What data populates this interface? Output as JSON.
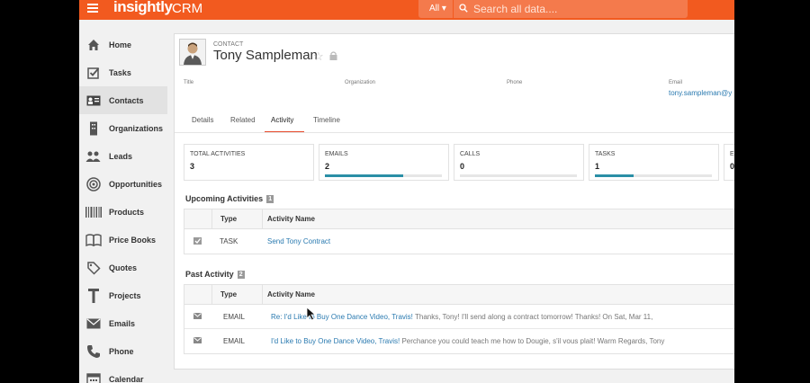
{
  "header": {
    "brand": "insightly",
    "product": "CRM",
    "search_scope": "All",
    "search_placeholder": "Search all data...."
  },
  "sidebar": {
    "items": [
      {
        "label": "Home",
        "icon": "home-icon"
      },
      {
        "label": "Tasks",
        "icon": "tasks-icon"
      },
      {
        "label": "Contacts",
        "icon": "contacts-icon",
        "active": true
      },
      {
        "label": "Organizations",
        "icon": "organizations-icon"
      },
      {
        "label": "Leads",
        "icon": "leads-icon"
      },
      {
        "label": "Opportunities",
        "icon": "opportunities-icon"
      },
      {
        "label": "Products",
        "icon": "products-icon"
      },
      {
        "label": "Price Books",
        "icon": "price-books-icon"
      },
      {
        "label": "Quotes",
        "icon": "quotes-icon"
      },
      {
        "label": "Projects",
        "icon": "projects-icon"
      },
      {
        "label": "Emails",
        "icon": "emails-icon"
      },
      {
        "label": "Phone",
        "icon": "phone-icon"
      },
      {
        "label": "Calendar",
        "icon": "calendar-icon"
      }
    ]
  },
  "record": {
    "type": "CONTACT",
    "name": "Tony Sampleman",
    "fields": {
      "title_label": "Title",
      "organization_label": "Organization",
      "phone_label": "Phone",
      "email_label": "Email",
      "email_value": "tony.sampleman@y"
    }
  },
  "tabs": [
    {
      "label": "Details"
    },
    {
      "label": "Related"
    },
    {
      "label": "Activity",
      "active": true
    },
    {
      "label": "Timeline"
    }
  ],
  "stats": [
    {
      "label": "TOTAL ACTIVITIES",
      "value": "3"
    },
    {
      "label": "EMAILS",
      "value": "2",
      "progress": 0.67
    },
    {
      "label": "CALLS",
      "value": "0",
      "progress": 0
    },
    {
      "label": "TASKS",
      "value": "1",
      "progress": 0.33
    },
    {
      "label": "E",
      "value": "0"
    }
  ],
  "upcoming": {
    "title": "Upcoming Activities",
    "count": "1",
    "columns": {
      "type": "Type",
      "name": "Activity Name"
    },
    "rows": [
      {
        "type": "TASK",
        "name": "Send Tony Contract",
        "icon": "checkbox-icon"
      }
    ]
  },
  "past": {
    "title": "Past Activity",
    "count": "2",
    "columns": {
      "type": "Type",
      "name": "Activity Name"
    },
    "rows": [
      {
        "type": "EMAIL",
        "icon": "envelope-icon",
        "subject": "Re: I'd Like to Buy One Dance Video, Travis!",
        "snippet": " Thanks, Tony! I'll send along a contract tomorrow! Thanks! On Sat, Mar 11,"
      },
      {
        "type": "EMAIL",
        "icon": "envelope-icon",
        "subject": "I'd Like to Buy One Dance Video, Travis!",
        "snippet": " Perchance you could teach me how to Dougie, s'il vous plait! Warm Regards, Tony"
      }
    ]
  },
  "colors": {
    "brand": "#f25a1f",
    "link": "#2a7ab0",
    "progress": "#2a8fa6",
    "active_tab": "#e84a2c"
  }
}
